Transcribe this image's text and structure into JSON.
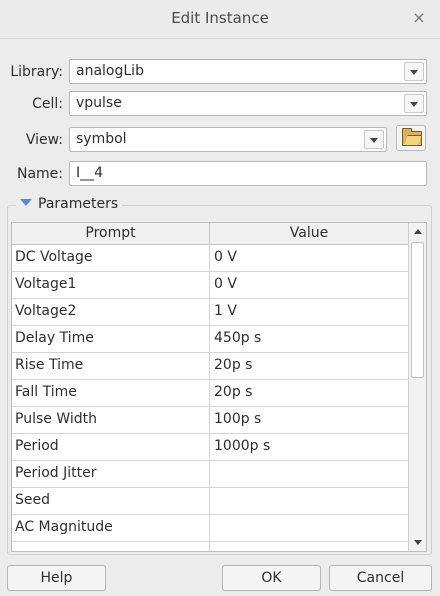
{
  "dialog": {
    "title": "Edit Instance",
    "close_glyph": "×"
  },
  "fields": {
    "library": {
      "label": "Library:",
      "value": "analogLib"
    },
    "cell": {
      "label": "Cell:",
      "value": "vpulse"
    },
    "view": {
      "label": "View:",
      "value": "symbol"
    },
    "name": {
      "label": "Name:",
      "value": "I__4"
    }
  },
  "parameters": {
    "title": "Parameters",
    "columns": {
      "prompt": "Prompt",
      "value": "Value"
    },
    "rows": [
      {
        "prompt": "DC Voltage",
        "value": "0 V"
      },
      {
        "prompt": "Voltage1",
        "value": "0 V"
      },
      {
        "prompt": "Voltage2",
        "value": "1 V"
      },
      {
        "prompt": "Delay Time",
        "value": "450p s"
      },
      {
        "prompt": "Rise Time",
        "value": "20p s"
      },
      {
        "prompt": "Fall Time",
        "value": "20p s"
      },
      {
        "prompt": "Pulse Width",
        "value": "100p s"
      },
      {
        "prompt": "Period",
        "value": "1000p s"
      },
      {
        "prompt": "Period Jitter",
        "value": ""
      },
      {
        "prompt": "Seed",
        "value": ""
      },
      {
        "prompt": "AC Magnitude",
        "value": ""
      },
      {
        "prompt": "",
        "value": ""
      }
    ]
  },
  "buttons": {
    "help": "Help",
    "ok": "OK",
    "cancel": "Cancel"
  },
  "icons": {
    "close": "close-icon",
    "dropdown": "chevron-down-icon",
    "browse": "folder-open-icon",
    "expand": "triangle-down-icon"
  }
}
